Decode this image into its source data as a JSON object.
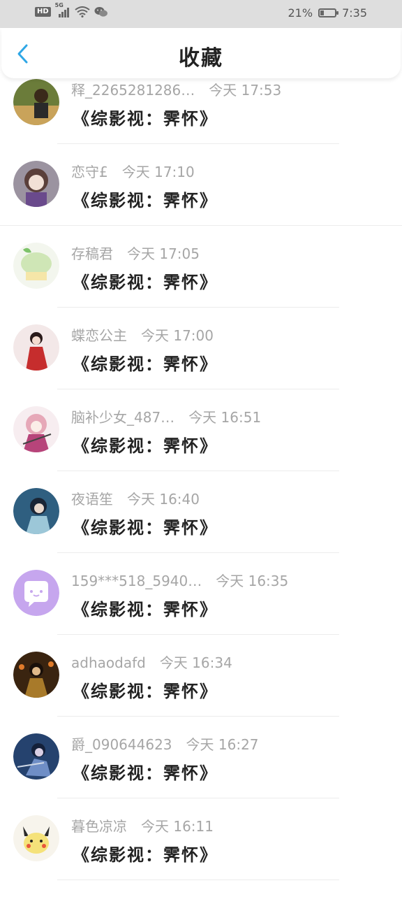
{
  "status_bar": {
    "network": "5G",
    "hd": "HD",
    "battery_percent": "21%",
    "battery_level": 0.21,
    "time": "7:35"
  },
  "header": {
    "title": "收藏",
    "back_icon": "chevron-left-icon",
    "accent_color": "#2fa7e6"
  },
  "items": [
    {
      "name": "释_2265281286…",
      "time": "今天 17:53",
      "text": "《综影视：霁怀》",
      "avatar_color": "#6b7c3a"
    },
    {
      "name": "恋守£",
      "time": "今天 17:10",
      "text": "《综影视：霁怀》",
      "avatar_color": "#8d7f95"
    },
    {
      "name": "存稿君",
      "time": "今天 17:05",
      "text": "《综影视：霁怀》",
      "avatar_color": "#d8ecc7"
    },
    {
      "name": "蝶恋公主",
      "time": "今天 17:00",
      "text": "《综影视：霁怀》",
      "avatar_color": "#c43a3a"
    },
    {
      "name": "脑补少女_487…",
      "time": "今天 16:51",
      "text": "《综影视：霁怀》",
      "avatar_color": "#e9b7c2"
    },
    {
      "name": "夜语笙",
      "time": "今天 16:40",
      "text": "《综影视：霁怀》",
      "avatar_color": "#3a6f8f"
    },
    {
      "name": "159***518_5940…",
      "time": "今天 16:35",
      "text": "《综影视：霁怀》",
      "avatar_color": "#c6a6ee"
    },
    {
      "name": "adhaodafd",
      "time": "今天 16:34",
      "text": "《综影视：霁怀》",
      "avatar_color": "#4a2e14"
    },
    {
      "name": "爵_090644623",
      "time": "今天 16:27",
      "text": "《综影视：霁怀》",
      "avatar_color": "#2a4a78"
    },
    {
      "name": "暮色凉凉",
      "time": "今天 16:11",
      "text": "《综影视：霁怀》",
      "avatar_color": "#f3e6a6"
    }
  ]
}
